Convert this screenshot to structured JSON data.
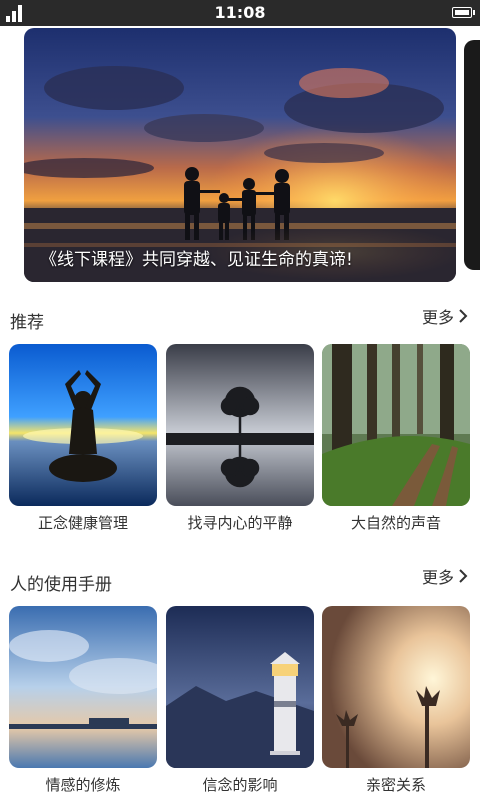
{
  "status_bar": {
    "time": "11:08"
  },
  "banner": {
    "caption": "《线下课程》共同穿越、见证生命的真谛!"
  },
  "sections": [
    {
      "title": "推荐",
      "more_label": "更多",
      "items": [
        {
          "label": "正念健康管理",
          "icon": "meditation-image"
        },
        {
          "label": "找寻内心的平静",
          "icon": "tree-reflection-image"
        },
        {
          "label": "大自然的声音",
          "icon": "forest-path-image"
        }
      ]
    },
    {
      "title": "人的使用手册",
      "more_label": "更多",
      "items": [
        {
          "label": "情感的修炼",
          "icon": "sky-lake-image"
        },
        {
          "label": "信念的影响",
          "icon": "lighthouse-image"
        },
        {
          "label": "亲密关系",
          "icon": "flower-sunset-image"
        }
      ]
    }
  ]
}
